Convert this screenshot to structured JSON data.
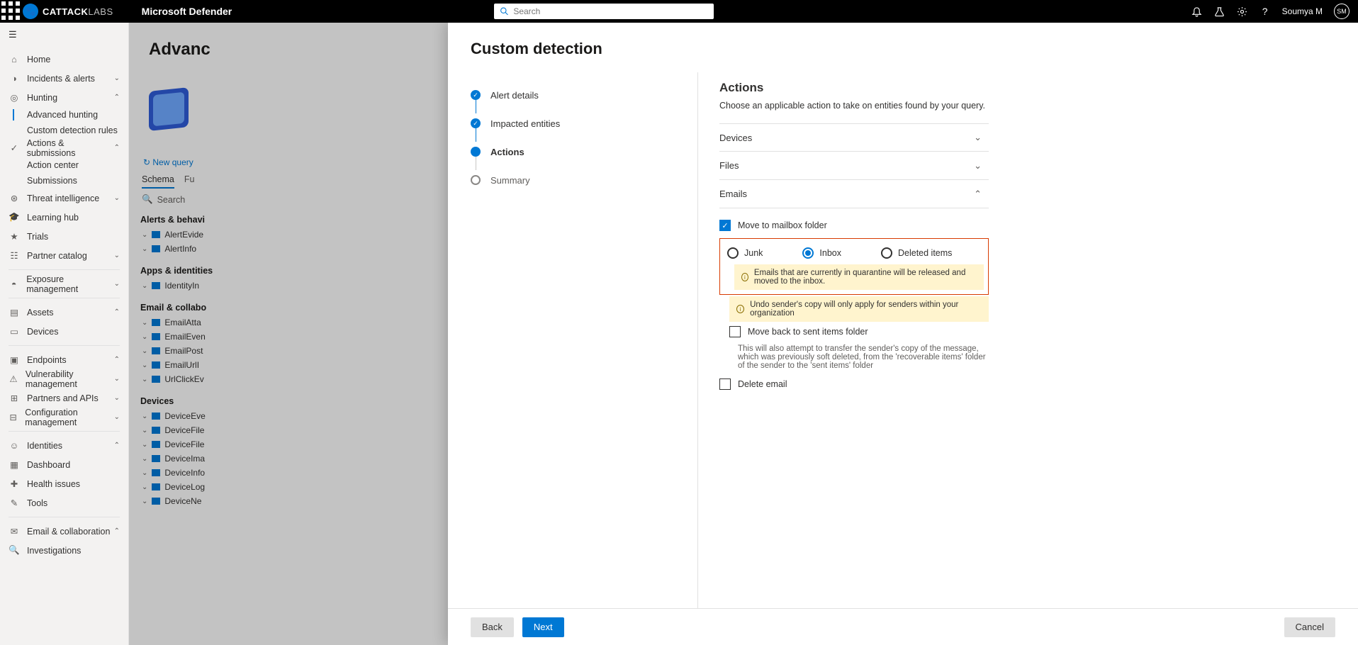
{
  "topbar": {
    "brand_cat": "CAT",
    "brand_tack": "TACK",
    "brand_labs": "LABS",
    "app": "Microsoft Defender",
    "search_placeholder": "Search",
    "user": "Soumya M",
    "avatar": "SM"
  },
  "nav": {
    "home": "Home",
    "incidents": "Incidents & alerts",
    "hunting": "Hunting",
    "adv_hunting": "Advanced hunting",
    "custom_rules": "Custom detection rules",
    "actions": "Actions & submissions",
    "action_center": "Action center",
    "submissions": "Submissions",
    "threat_intel": "Threat intelligence",
    "learning": "Learning hub",
    "trials": "Trials",
    "partner_catalog": "Partner catalog",
    "exposure": "Exposure management",
    "assets": "Assets",
    "devices": "Devices",
    "endpoints": "Endpoints",
    "vuln": "Vulnerability management",
    "partners_apis": "Partners and APIs",
    "config_mgmt": "Configuration management",
    "identities": "Identities",
    "dashboard": "Dashboard",
    "health": "Health issues",
    "tools": "Tools",
    "email_collab": "Email & collaboration",
    "investigations": "Investigations"
  },
  "bg": {
    "title": "Advanc",
    "new_query": "New query",
    "tab_schema": "Schema",
    "tab_fu": "Fu",
    "search": "Search",
    "sec_alerts": "Alerts & behavi",
    "AlertEvide": "AlertEvide",
    "AlertInfo": "AlertInfo",
    "sec_apps": "Apps & identities",
    "IdentityIn": "IdentityIn",
    "sec_email": "Email & collabo",
    "EmailAtta": "EmailAtta",
    "EmailEven": "EmailEven",
    "EmailPost": "EmailPost",
    "EmailUrlI": "EmailUrlI",
    "UrlClickEv": "UrlClickEv",
    "sec_devices": "Devices",
    "DeviceEve": "DeviceEve",
    "DeviceFile1": "DeviceFile",
    "DeviceFile2": "DeviceFile",
    "DeviceIma": "DeviceIma",
    "DeviceInfo": "DeviceInfo",
    "DeviceLog": "DeviceLog",
    "DeviceNe": "DeviceNe"
  },
  "panel": {
    "title": "Custom detection",
    "step1": "Alert details",
    "step2": "Impacted entities",
    "step3": "Actions",
    "step4": "Summary",
    "actions_h": "Actions",
    "actions_desc": "Choose an applicable action to take on entities found by your query.",
    "acc_devices": "Devices",
    "acc_files": "Files",
    "acc_emails": "Emails",
    "cb_move": "Move to mailbox folder",
    "r_junk": "Junk",
    "r_inbox": "Inbox",
    "r_deleted": "Deleted items",
    "info_inbox": "Emails that are currently in quarantine will be released and moved to the inbox.",
    "info_undo": "Undo sender's copy will only apply for senders within your organization",
    "cb_moveback": "Move back to sent items folder",
    "moveback_help": "This will also attempt to transfer the sender's copy of the message, which was previously soft deleted, from the 'recoverable items' folder of the sender to the 'sent items' folder",
    "cb_delete": "Delete email",
    "btn_back": "Back",
    "btn_next": "Next",
    "btn_cancel": "Cancel"
  }
}
